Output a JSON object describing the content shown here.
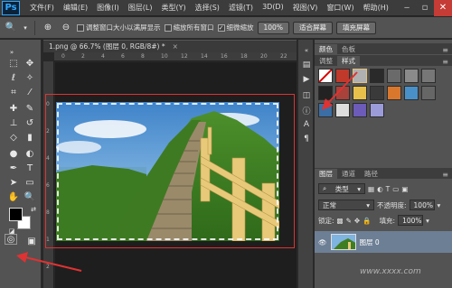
{
  "app": {
    "logo": "Ps",
    "menu": [
      "文件(F)",
      "编辑(E)",
      "图像(I)",
      "图层(L)",
      "类型(Y)",
      "选择(S)",
      "滤镜(T)",
      "3D(D)",
      "视图(V)",
      "窗口(W)",
      "帮助(H)"
    ],
    "window_controls": [
      "minimize-icon",
      "restore-icon",
      "close-icon"
    ]
  },
  "options": {
    "checkbox1_label": "调整窗口大小以满屏显示",
    "checkbox2_label": "缩放所有窗口",
    "checkbox3_label": "细微缩放",
    "zoom_value": "100%",
    "fit_screen": "适合屏幕",
    "fill_screen": "填充屏幕"
  },
  "document": {
    "tab_title": "1.png @ 66.7% (图层 0, RGB/8#) *",
    "tab_close": "×",
    "ruler_top": [
      "0",
      "2",
      "4",
      "6",
      "8",
      "10",
      "12",
      "14",
      "16",
      "18",
      "20",
      "22"
    ],
    "ruler_left": [
      "0",
      "2",
      "4",
      "6",
      "8",
      "1",
      "2"
    ]
  },
  "panels": {
    "top_tabs": [
      "颜色",
      "色板"
    ],
    "style_tabs": [
      "调整",
      "样式"
    ],
    "layer_tabs": [
      "图层",
      "通道",
      "路径"
    ],
    "kind_label": "类型",
    "blend_mode": "正常",
    "opacity_label": "不透明度:",
    "opacity_value": "100%",
    "lock_label": "锁定:",
    "fill_label": "填充:",
    "fill_value": "100%",
    "layer_name": "图层 0"
  },
  "watermark": "www.xxxx.com"
}
